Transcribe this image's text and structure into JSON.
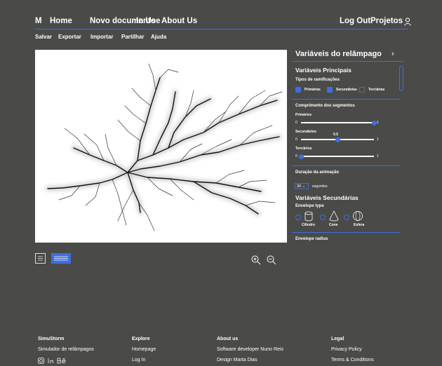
{
  "nav": {
    "logo": "M",
    "items": [
      "Home",
      "Novo documento",
      "In Use",
      "About Us"
    ],
    "logout": "Log Out",
    "projects": "Projetos",
    "user_icon": "user-icon"
  },
  "toolbar": {
    "items": [
      "Salvar",
      "Exportar",
      "Importar",
      "Partilhar",
      "Ajuda"
    ]
  },
  "panel": {
    "title": "Variáveis do relâmpago",
    "primary_heading": "Variáveis Principais",
    "branch_types_label": "Tipos de ramificações",
    "branch_types": [
      {
        "label": "Primárias",
        "checked": true
      },
      {
        "label": "Secundárias",
        "checked": true
      },
      {
        "label": "Terciárias",
        "checked": false
      }
    ],
    "segment_length_label": "Comprimento dos segmentos",
    "sliders": [
      {
        "label": "Primários",
        "min": "0",
        "max": "1",
        "value": 1
      },
      {
        "label": "Secundários",
        "min": "0",
        "max": "1",
        "value": 0.5,
        "value_label": "0.5"
      },
      {
        "label": "Terciários",
        "min": "0",
        "max": "1",
        "value": 0
      }
    ],
    "animation_label": "Duração da animação",
    "animation_value": "30",
    "animation_unit": "segundos",
    "secondary_heading": "Variáveis Secundárias",
    "envelope_type_label": "Envelope type",
    "envelope_types": [
      "Cilindro",
      "Cone",
      "Esfera"
    ],
    "envelope_radius_label": "Envelope radius",
    "accent": "#3d6fe0"
  },
  "footer": {
    "columns": [
      {
        "heading": "SimuStorm",
        "lines": [
          "Simulador de relâmpagos"
        ],
        "icons": [
          "instagram-icon",
          "linkedin-icon",
          "behance-icon"
        ]
      },
      {
        "heading": "Explore",
        "lines": [
          "Homepage",
          "Log In"
        ]
      },
      {
        "heading": "About us",
        "lines": [
          "Software developer Nuno Reis",
          "Design Marta Dias"
        ]
      },
      {
        "heading": "Legal",
        "lines": [
          "Privacy Policy",
          "Terms & Conditions"
        ]
      }
    ]
  }
}
